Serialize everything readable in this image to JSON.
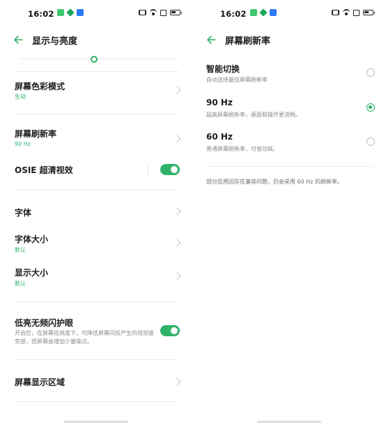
{
  "left_screen": {
    "status": {
      "time": "16:02"
    },
    "title": "显示与亮度",
    "brightness_level": 0.5,
    "items": [
      {
        "title": "屏幕色彩模式",
        "value": "生动"
      },
      {
        "title": "屏幕刷新率",
        "value": "90 Hz"
      },
      {
        "title": "OSIE 超清视效",
        "toggle": true
      },
      {
        "title": "字体"
      },
      {
        "title": "字体大小",
        "value": "默认"
      },
      {
        "title": "显示大小",
        "value": "默认"
      },
      {
        "title": "低亮无频闪护眼",
        "desc": "开启后，在屏幕低亮度下，可降低屏幕闪烁产生的视觉疲劳感，但屏幕会增加少量噪点。",
        "toggle": true
      },
      {
        "title": "屏幕显示区域"
      }
    ]
  },
  "right_screen": {
    "status": {
      "time": "16:02"
    },
    "title": "屏幕刷新率",
    "options": [
      {
        "title": "智能切换",
        "desc": "自动选择最佳屏幕刷新率",
        "selected": false
      },
      {
        "title": "90 Hz",
        "desc": "超高屏幕刷新率，画面和操作更流畅。",
        "selected": true
      },
      {
        "title": "60 Hz",
        "desc": "普通屏幕刷新率，可省功耗。",
        "selected": false
      }
    ],
    "note": "部分应用因存在兼容问题，仍会采用 60 Hz 的刷新率。"
  },
  "colors": {
    "accent": "#2fb36a"
  }
}
